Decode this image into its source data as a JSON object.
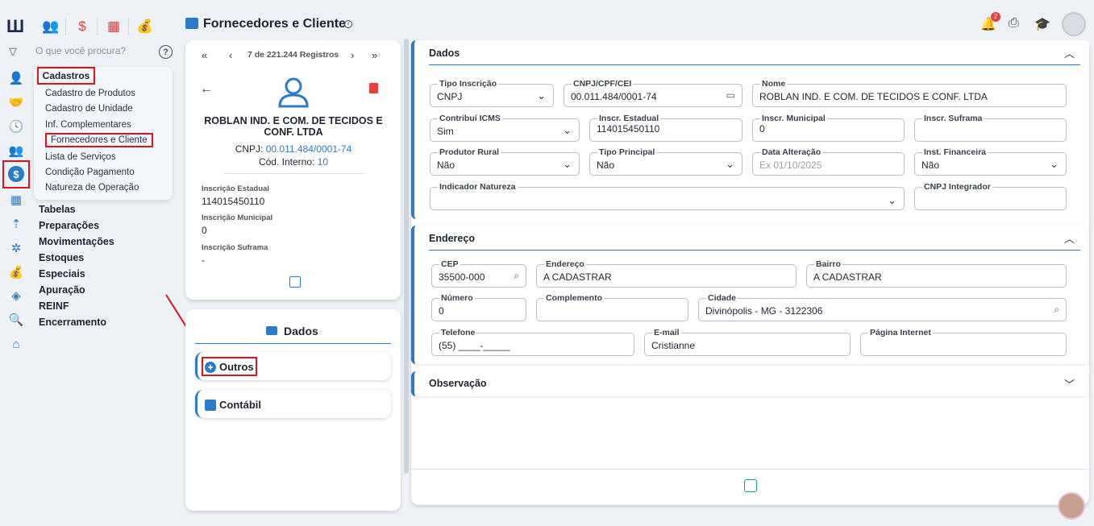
{
  "app": {
    "page_title": "Fornecedores e Cliente",
    "info_icon": "info-icon",
    "search_placeholder": "O que você procura?",
    "help_label": "?"
  },
  "menu": {
    "title": "Cadastros",
    "items": [
      "Cadastro de Produtos",
      "Cadastro de Unidade",
      "Inf. Complementares",
      "Fornecedores e Cliente",
      "Lista de Serviços",
      "Condição Pagamento",
      "Natureza de Operação"
    ],
    "groups": [
      "Tabelas",
      "Preparações",
      "Movimentações",
      "Estoques",
      "Especiais",
      "Apuração",
      "REINF",
      "Encerramento"
    ]
  },
  "notifications": {
    "count": "2"
  },
  "record": {
    "nav_text": "7 de 221.244 Registros",
    "name": "ROBLAN IND. E COM. DE TECIDOS E CONF. LTDA",
    "cnpj_label": "CNPJ:",
    "cnpj_value": "00.011.484/0001-74",
    "codigo_label": "Cód. Interno:",
    "codigo_value": "10",
    "ie_label": "Inscrição Estadual",
    "ie_value": "114015450110",
    "im_label": "Inscrição Municipal",
    "im_value": "0",
    "is_label": "Inscrição Suframa",
    "is_value": "-"
  },
  "side_menu": {
    "title": "Dados",
    "outros": "Outros",
    "contabil": "Contábil"
  },
  "dados": {
    "title": "Dados",
    "tipo_inscricao": {
      "label": "Tipo Inscrição",
      "value": "CNPJ"
    },
    "cnpj": {
      "label": "CNPJ/CPF/CEI",
      "value": "00.011.484/0001-74"
    },
    "nome": {
      "label": "Nome",
      "value": "ROBLAN  IND. E COM. DE TECIDOS E CONF. LTDA"
    },
    "icms": {
      "label": "Contribuí ICMS",
      "value": "Sim"
    },
    "ie": {
      "label": "Inscr. Estadual",
      "value": "114015450110"
    },
    "im": {
      "label": "Inscr. Municipal",
      "value": "0"
    },
    "is": {
      "label": "Inscr. Suframa",
      "value": ""
    },
    "produtor": {
      "label": "Produtor Rural",
      "value": "Não"
    },
    "tipo_principal": {
      "label": "Tipo Principal",
      "value": "Não"
    },
    "data_alt": {
      "label": "Data Alteração",
      "placeholder": "Ex 01/10/2025"
    },
    "inst_fin": {
      "label": "Inst. Financeira",
      "value": "Não"
    },
    "ind_nat": {
      "label": "Indicador Natureza",
      "value": ""
    },
    "cnpj_int": {
      "label": "CNPJ Integrador",
      "value": ""
    }
  },
  "endereco": {
    "title": "Endereço",
    "cep": {
      "label": "CEP",
      "value": "35500-000"
    },
    "endereco": {
      "label": "Endereço",
      "value": "A CADASTRAR"
    },
    "bairro": {
      "label": "Bairro",
      "value": "A CADASTRAR"
    },
    "numero": {
      "label": "Número",
      "value": "0"
    },
    "complemento": {
      "label": "Complemento",
      "value": ""
    },
    "cidade": {
      "label": "Cidade",
      "value": "Divinópolis - MG - 3122306"
    },
    "telefone": {
      "label": "Telefone",
      "value": "(55) ____-_____"
    },
    "email": {
      "label": "E-mail",
      "value": "Cristianne"
    },
    "pagina": {
      "label": "Página Internet",
      "value": ""
    }
  },
  "observacao": {
    "title": "Observação"
  },
  "colors": {
    "accent": "#2a7bc9",
    "highlight": "#e5101a"
  }
}
